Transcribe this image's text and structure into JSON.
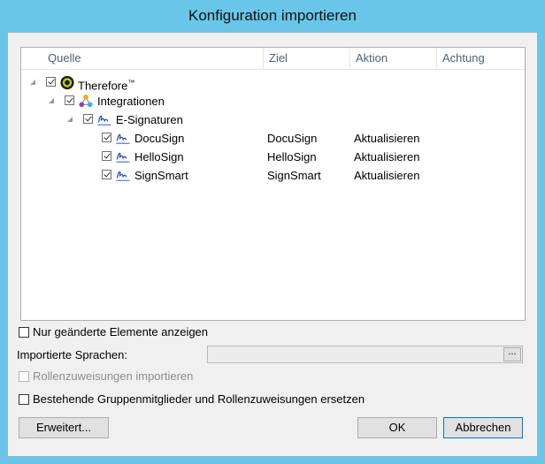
{
  "window": {
    "title": "Konfiguration importieren"
  },
  "tree": {
    "columns": [
      "Quelle",
      "Ziel",
      "Aktion",
      "Achtung"
    ],
    "rows": [
      {
        "label": "Therefore",
        "superscript": "™",
        "ziel": "",
        "aktion": "",
        "achtung": "",
        "icon": "therefore-logo-icon"
      },
      {
        "label": "Integrationen",
        "ziel": "",
        "aktion": "",
        "achtung": "",
        "icon": "integrations-icon"
      },
      {
        "label": "E-Signaturen",
        "ziel": "",
        "aktion": "",
        "achtung": "",
        "icon": "signature-icon"
      },
      {
        "label": "DocuSign",
        "ziel": "DocuSign",
        "aktion": "Aktualisieren",
        "achtung": "",
        "icon": "signature-icon"
      },
      {
        "label": "HelloSign",
        "ziel": "HelloSign",
        "aktion": "Aktualisieren",
        "achtung": "",
        "icon": "signature-icon"
      },
      {
        "label": "SignSmart",
        "ziel": "SignSmart",
        "aktion": "Aktualisieren",
        "achtung": "",
        "icon": "signature-icon"
      }
    ]
  },
  "options": {
    "only_changed": "Nur geänderte Elemente anzeigen",
    "languages_label": "Importierte Sprachen:",
    "languages_value": "",
    "browse": "...",
    "role_assign": "Rollenzuweisungen importieren",
    "replace_members": "Bestehende Gruppenmitglieder und Rollenzuweisungen ersetzen"
  },
  "buttons": {
    "advanced": "Erweitert...",
    "ok": "OK",
    "cancel": "Abbrechen"
  },
  "colors": {
    "frame": "#69c6e8",
    "header_text": "#4c607a",
    "default_button_border": "#0078d7"
  }
}
